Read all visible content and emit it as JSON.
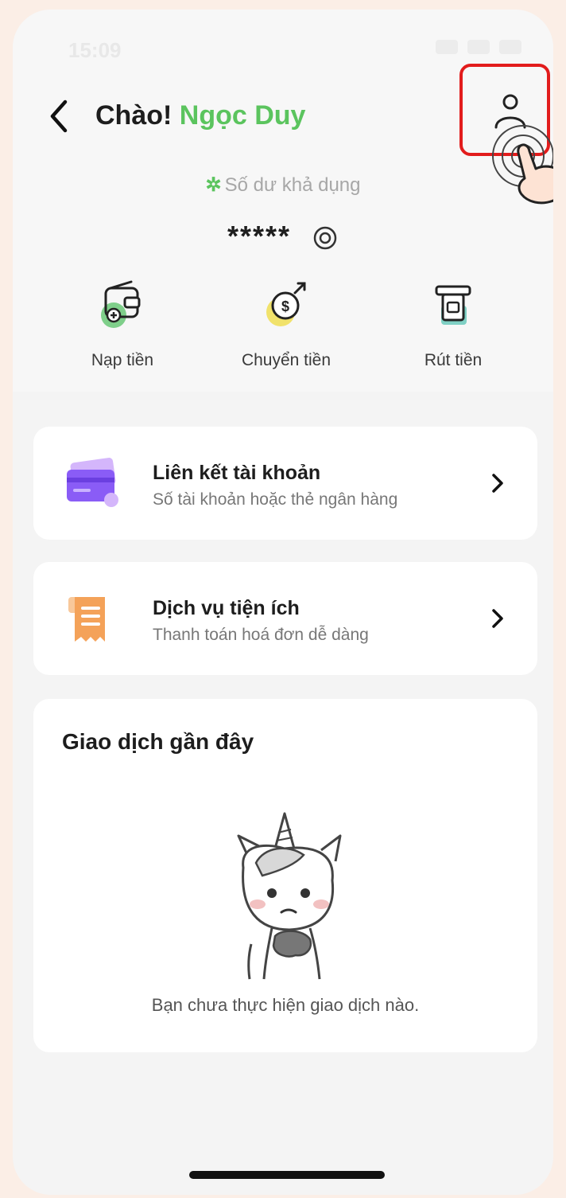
{
  "status_bar": {
    "time": "15:09"
  },
  "header": {
    "greeting": "Chào!",
    "name": "Ngọc Duy"
  },
  "balance": {
    "label": "Số dư khả dụng",
    "value": "*****"
  },
  "actions": [
    {
      "label": "Nạp tiền",
      "icon": "wallet-add-icon"
    },
    {
      "label": "Chuyển tiền",
      "icon": "money-transfer-icon"
    },
    {
      "label": "Rút tiền",
      "icon": "atm-withdraw-icon"
    }
  ],
  "cards": [
    {
      "title": "Liên kết tài khoản",
      "subtitle": "Số tài khoản hoặc thẻ ngân hàng",
      "icon": "credit-card-icon"
    },
    {
      "title": "Dịch vụ tiện ích",
      "subtitle": "Thanh toán hoá đơn dễ dàng",
      "icon": "receipt-icon"
    }
  ],
  "transactions": {
    "title": "Giao dịch gần đây",
    "empty_text": "Bạn chưa thực hiện giao dịch nào."
  },
  "colors": {
    "accent_green": "#5bc45e",
    "highlight_red": "#e21c1c",
    "card_purple": "#8a5cf6",
    "receipt_orange": "#f4a259"
  }
}
